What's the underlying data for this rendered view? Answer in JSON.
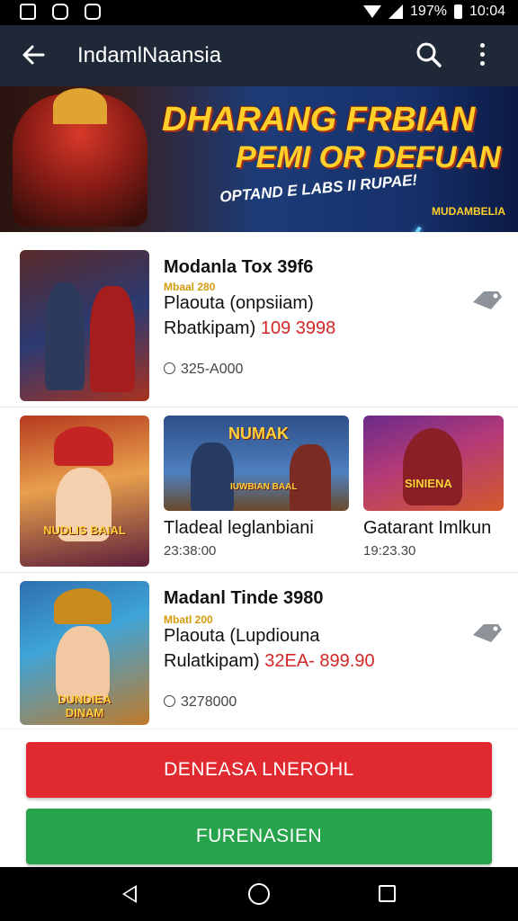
{
  "status_bar": {
    "battery_text": "197%",
    "time": "10:04"
  },
  "app_bar": {
    "title": "IndamlNaansia"
  },
  "banner": {
    "line1": "DHARANG FRBIAN",
    "line2": "PEMI OR DEFUAN",
    "line3": "OPTAND E LABS II RUPAE!",
    "badge": "MUDAMBELIA"
  },
  "items": [
    {
      "title": "Modanla Tox 39f6",
      "badge": "Mbaal 280",
      "subtitle": "Plaouta (onpsiiam)",
      "price_label": "Rbatkipam)",
      "price_value": "109 3998",
      "meta": "325-A000"
    },
    {
      "title": "Madanl Tinde 3980",
      "badge": "Mbatl 200",
      "subtitle": "Plaouta (Lupdiouna",
      "price_label": "Rulatkipam)",
      "price_value": "32EA- 899.90",
      "meta": "3278000"
    }
  ],
  "thumb_overlays": {
    "t1": "NUDLIS BAIAL",
    "t2": "NUMAK",
    "t2b": "IUWBIAN BAAL",
    "t3": "SINIENA",
    "t4": "DUNDIEA DINAM"
  },
  "cards": [
    {
      "title": "Tladeal leglanbiani",
      "meta": "23:38:00"
    },
    {
      "title": "Gatarant Imlkun",
      "meta": "19:23.30"
    }
  ],
  "buttons": {
    "primary": "DENEASA LNEROHL",
    "secondary": "FURENASIEN"
  },
  "colors": {
    "appbar": "#1f2837",
    "primary": "#e02a2f",
    "secondary": "#27a44b",
    "price": "#d32626"
  }
}
